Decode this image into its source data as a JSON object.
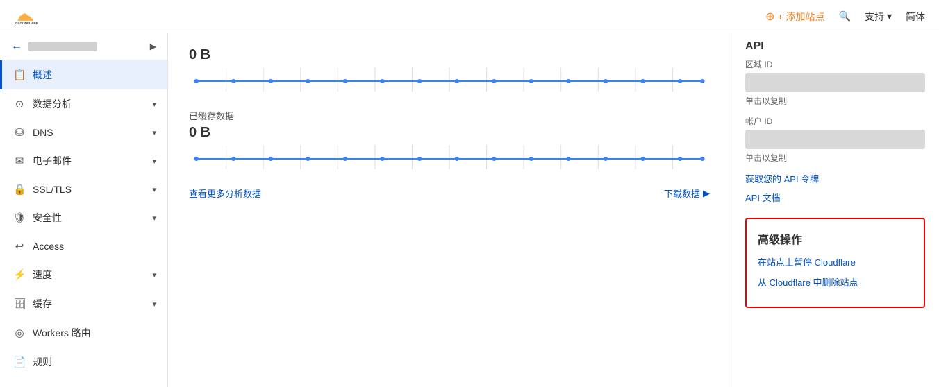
{
  "topNav": {
    "addSiteLabel": "+ 添加站点",
    "searchIcon": "search-icon",
    "supportLabel": "支持",
    "langLabel": "简体"
  },
  "sidebar": {
    "domainPlaceholder": "",
    "items": [
      {
        "id": "overview",
        "label": "概述",
        "icon": "📋",
        "active": true,
        "hasArrow": false
      },
      {
        "id": "analytics",
        "label": "数据分析",
        "icon": "🕐",
        "active": false,
        "hasArrow": true
      },
      {
        "id": "dns",
        "label": "DNS",
        "icon": "🔗",
        "active": false,
        "hasArrow": true
      },
      {
        "id": "email",
        "label": "电子邮件",
        "icon": "✉",
        "active": false,
        "hasArrow": true
      },
      {
        "id": "ssl",
        "label": "SSL/TLS",
        "icon": "🔒",
        "active": false,
        "hasArrow": true
      },
      {
        "id": "security",
        "label": "安全性",
        "icon": "🛡",
        "active": false,
        "hasArrow": true
      },
      {
        "id": "access",
        "label": "Access",
        "icon": "↩",
        "active": false,
        "hasArrow": false
      },
      {
        "id": "speed",
        "label": "速度",
        "icon": "⚡",
        "active": false,
        "hasArrow": true
      },
      {
        "id": "cache",
        "label": "缓存",
        "icon": "🗄",
        "active": false,
        "hasArrow": true
      },
      {
        "id": "workers",
        "label": "Workers 路由",
        "icon": "⊕",
        "active": false,
        "hasArrow": false
      },
      {
        "id": "rules",
        "label": "规则",
        "icon": "📄",
        "active": false,
        "hasArrow": false
      }
    ]
  },
  "mainContent": {
    "cachedSection": {
      "label": "已缓存数据",
      "value1": "0 B",
      "value2": "0 B"
    },
    "links": {
      "viewMore": "查看更多分析数据",
      "download": "下载数据"
    }
  },
  "rightPanel": {
    "apiTitle": "API",
    "zoneidTitle": "区域 ID",
    "zoneidPlaceholder": "",
    "zoneClickLabel": "单击以复制",
    "accountidTitle": "帐户 ID",
    "accountidPlaceholder": "",
    "accountClickLabel": "单击以复制",
    "getTokenLink": "获取您的 API 令牌",
    "apiDocsLink": "API 文档",
    "advancedTitle": "高级操作",
    "pauseLink": "在站点上暂停 Cloudflare",
    "removeLink": "从 Cloudflare 中删除站点"
  }
}
